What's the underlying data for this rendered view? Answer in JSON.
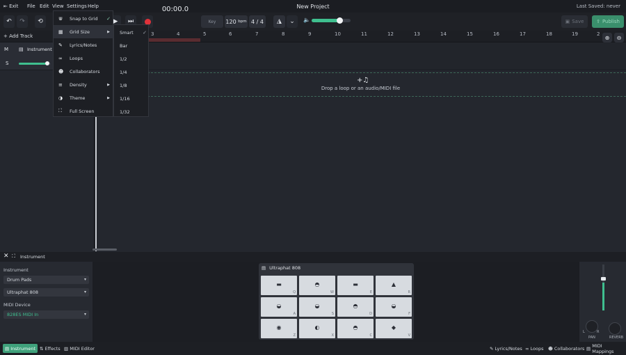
{
  "menubar": {
    "exit": "Exit",
    "menus": [
      "File",
      "Edit",
      "View",
      "Settings",
      "Help"
    ],
    "title": "New Project",
    "last_saved": "Last Saved: never"
  },
  "toolbar": {
    "time": "00:00.0",
    "key_label": "Key",
    "bpm_value": "120",
    "bpm_unit": "bpm",
    "time_signature": "4 / 4",
    "volume_fraction": 0.72,
    "save_label": "Save",
    "publish_label": "Publish"
  },
  "tracks": {
    "add_track_label": "Add Track",
    "mute_label": "M",
    "solo_label": "S",
    "track_name": "Instrument",
    "track_volume_fraction": 0.9
  },
  "ruler": {
    "ticks": [
      "3",
      "4",
      "5",
      "6",
      "7",
      "8",
      "9",
      "10",
      "11",
      "12",
      "13",
      "14",
      "15",
      "16",
      "17",
      "18",
      "19",
      "2"
    ]
  },
  "arrangement": {
    "drop_text": "Drop a loop or an audio/MIDI file"
  },
  "settings_menu": {
    "items": [
      {
        "label": "Snap to Grid",
        "icon": "magnet-icon",
        "checked": true
      },
      {
        "label": "Grid Size",
        "icon": "grid-icon",
        "submenu": true
      },
      {
        "label": "Lyrics/Notes",
        "icon": "pencil-icon"
      },
      {
        "label": "Loops",
        "icon": "loop-icon"
      },
      {
        "label": "Collaborators",
        "icon": "users-icon"
      },
      {
        "label": "Density",
        "icon": "density-icon",
        "submenu": true
      },
      {
        "label": "Theme",
        "icon": "palette-icon",
        "submenu": true
      },
      {
        "label": "Full Screen",
        "icon": "fullscreen-icon"
      }
    ]
  },
  "grid_menu": {
    "items": [
      {
        "label": "Smart",
        "checked": true
      },
      {
        "label": "Bar"
      },
      {
        "label": "1/2"
      },
      {
        "label": "1/4"
      },
      {
        "label": "1/8"
      },
      {
        "label": "1/16"
      },
      {
        "label": "1/32"
      }
    ]
  },
  "bottom_panel": {
    "header_label": "Instrument",
    "instrument_label": "Instrument",
    "instrument_type": "Drum Pads",
    "instrument_preset": "Ultraphat 808",
    "midi_device_label": "MIDI Device",
    "midi_device_value": "828ES MIDI In",
    "pad_window_title": "Ultraphat 808",
    "pads": [
      {
        "glyph": "▬",
        "key": "Q"
      },
      {
        "glyph": "◓",
        "key": "W"
      },
      {
        "glyph": "▬",
        "key": "E"
      },
      {
        "glyph": "▲",
        "key": "R"
      },
      {
        "glyph": "◒",
        "key": "A"
      },
      {
        "glyph": "◒",
        "key": "S"
      },
      {
        "glyph": "◓",
        "key": "D"
      },
      {
        "glyph": "◒",
        "key": "F"
      },
      {
        "glyph": "◉",
        "key": "Z"
      },
      {
        "glyph": "◐",
        "key": "X"
      },
      {
        "glyph": "◓",
        "key": "C"
      },
      {
        "glyph": "◆",
        "key": "V"
      }
    ],
    "pan_label": "PAN",
    "reverb_label": "REVERB",
    "pan_left": "L",
    "pan_right": "R",
    "output_level_fraction": 0.6
  },
  "statusbar": {
    "left_tabs": [
      "Instrument",
      "Effects",
      "MIDI Editor"
    ],
    "right_buttons": [
      "Lyrics/Notes",
      "Loops",
      "Collaborators",
      "MIDI Mappings"
    ]
  },
  "colors": {
    "accent": "#3fbf8f",
    "record": "#e0323a",
    "background": "#24272e"
  }
}
